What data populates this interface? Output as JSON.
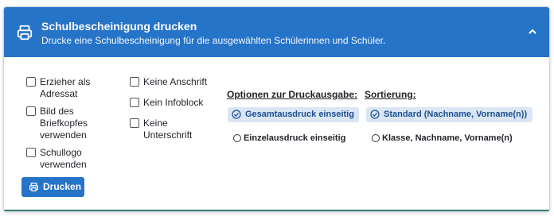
{
  "header": {
    "title": "Schulbescheinigung drucken",
    "subtitle": "Drucke eine Schulbescheinigung für die ausgewählten Schülerinnen und Schüler.",
    "icon": "printer-icon",
    "collapse_icon": "chevron-up-icon"
  },
  "checkboxes": {
    "col1": [
      {
        "line1": "Erzieher als",
        "line2": "Adressat",
        "line3": "",
        "checked": false
      },
      {
        "line1": "Bild des",
        "line2": "Briefkopfes",
        "line3": "verwenden",
        "checked": false
      },
      {
        "line1": "Schullogo",
        "line2": "verwenden",
        "line3": "",
        "checked": false
      }
    ],
    "col2": [
      {
        "line1": "Keine Anschrift",
        "line2": "",
        "checked": false
      },
      {
        "line1": "Kein Infoblock",
        "line2": "",
        "checked": false
      },
      {
        "line1": "Keine",
        "line2": "Unterschrift",
        "checked": false
      }
    ]
  },
  "druckausgabe": {
    "title": "Optionen zur Druckausgabe:",
    "options": [
      "Gesamtausdruck einseitig",
      "Einzelausdruck einseitig"
    ],
    "selected": "Gesamtausdruck einseitig"
  },
  "sortierung": {
    "title": "Sortierung:",
    "options": [
      "Standard (Nachname, Vorname(n))",
      "Klasse, Nachname, Vorname(n)"
    ],
    "selected": "Standard (Nachname, Vorname(n))"
  },
  "print_button": {
    "label": "Drucken",
    "icon": "printer-icon"
  },
  "colors": {
    "primary": "#2674c8",
    "selected_bg": "#dbe6f4",
    "selected_text": "#1b4f91",
    "accent_bottom": "#3a7e75"
  }
}
